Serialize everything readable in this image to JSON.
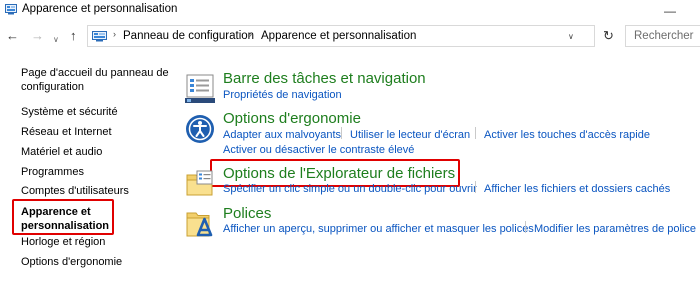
{
  "window": {
    "title": "Apparence et personnalisation",
    "minimize_glyph": "—",
    "title_icon": "control-panel-icon"
  },
  "nav": {
    "back_glyph": "←",
    "forward_glyph": "→",
    "recent_glyph": "∨",
    "up_glyph": "↑",
    "crumb_sep": "›",
    "breadcrumbs": [
      "Panneau de configuration",
      "Apparence et personnalisation"
    ],
    "dropdown_glyph": "∨",
    "refresh_glyph": "↻",
    "search_placeholder": "Rechercher"
  },
  "sidebar": {
    "home": "Page d'accueil du panneau de configuration",
    "home_line1": "Page d'accueil du panneau de",
    "home_line2": "configuration",
    "items": [
      "Système et sécurité",
      "Réseau et Internet",
      "Matériel et audio",
      "Programmes",
      "Comptes d'utilisateurs",
      "Apparence et personnalisation",
      "Horloge et région",
      "Options d'ergonomie"
    ],
    "active_line1": "Apparence et",
    "active_line2": "personnalisation",
    "active_index": 5
  },
  "categories": [
    {
      "title": "Barre des tâches et navigation",
      "icon": "taskbar-icon",
      "links": [
        "Propriétés de navigation"
      ]
    },
    {
      "title": "Options d'ergonomie",
      "icon": "ease-of-access-icon",
      "links": [
        "Adapter aux malvoyants",
        "Utiliser le lecteur d'écran",
        "Activer les touches d'accès rapide",
        "Activer ou désactiver le contraste élevé"
      ]
    },
    {
      "title": "Options de l'Explorateur de fichiers",
      "icon": "folder-options-icon",
      "highlighted": true,
      "links": [
        "Spécifier un clic simple ou un double-clic pour ouvrir",
        "Afficher les fichiers et dossiers cachés"
      ]
    },
    {
      "title": "Polices",
      "icon": "fonts-folder-icon",
      "links": [
        "Afficher un aperçu, supprimer ou afficher et masquer les polices",
        "Modifier les paramètres de police"
      ]
    }
  ],
  "colors": {
    "category_title": "#1e7e1e",
    "link": "#0a55c0",
    "highlight_box": "#e00000",
    "icon_blue": "#1f5fb0"
  }
}
